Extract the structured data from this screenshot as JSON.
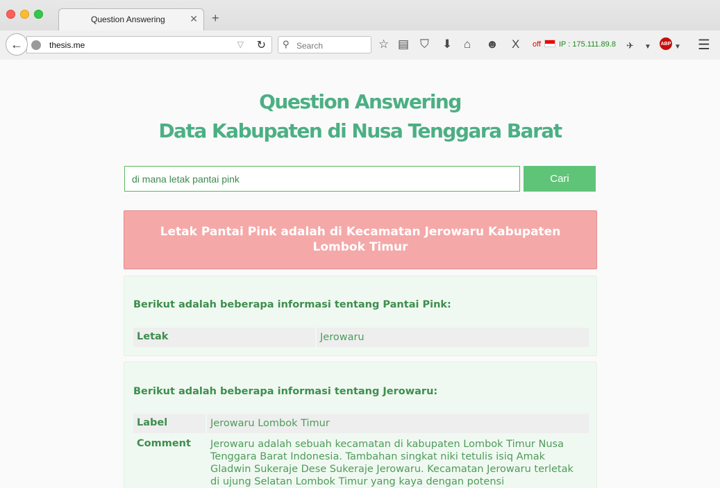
{
  "browser": {
    "tab_title": "Question Answering",
    "tab_close": "✕",
    "new_tab": "+",
    "url": "thesis.me",
    "search_placeholder": "Search",
    "ext_status": "off",
    "ip_label": "IP : 175.111.89.8",
    "abp_label": "ABP"
  },
  "page": {
    "title_line1": "Question Answering",
    "title_line2": "Data Kabupaten di Nusa Tenggara Barat",
    "query": "di mana letak pantai pink",
    "submit_label": "Cari",
    "answer": "Letak Pantai Pink adalah di Kecamatan Jerowaru Kabupaten Lombok Timur",
    "info_cards": [
      {
        "title": "Berikut adalah beberapa informasi tentang Pantai Pink:",
        "rows": [
          {
            "key": "Letak",
            "value": "Jerowaru"
          }
        ]
      },
      {
        "title": "Berikut adalah beberapa informasi tentang Jerowaru:",
        "rows": [
          {
            "key": "Label",
            "value": "Jerowaru Lombok Timur"
          },
          {
            "key": "Comment",
            "value": "Jerowaru adalah sebuah kecamatan di kabupaten Lombok Timur Nusa Tenggara Barat Indonesia. Tambahan singkat niki tetulis isiq Amak Gladwin Sukeraje Dese Sukeraje Jerowaru. Kecamatan Jerowaru terletak di ujung Selatan Lombok Timur yang kaya dengan potensi"
          }
        ]
      }
    ]
  },
  "colors": {
    "accent_green": "#4caf84",
    "button_green": "#5fc478",
    "answer_pink": "#f5a8a8"
  }
}
